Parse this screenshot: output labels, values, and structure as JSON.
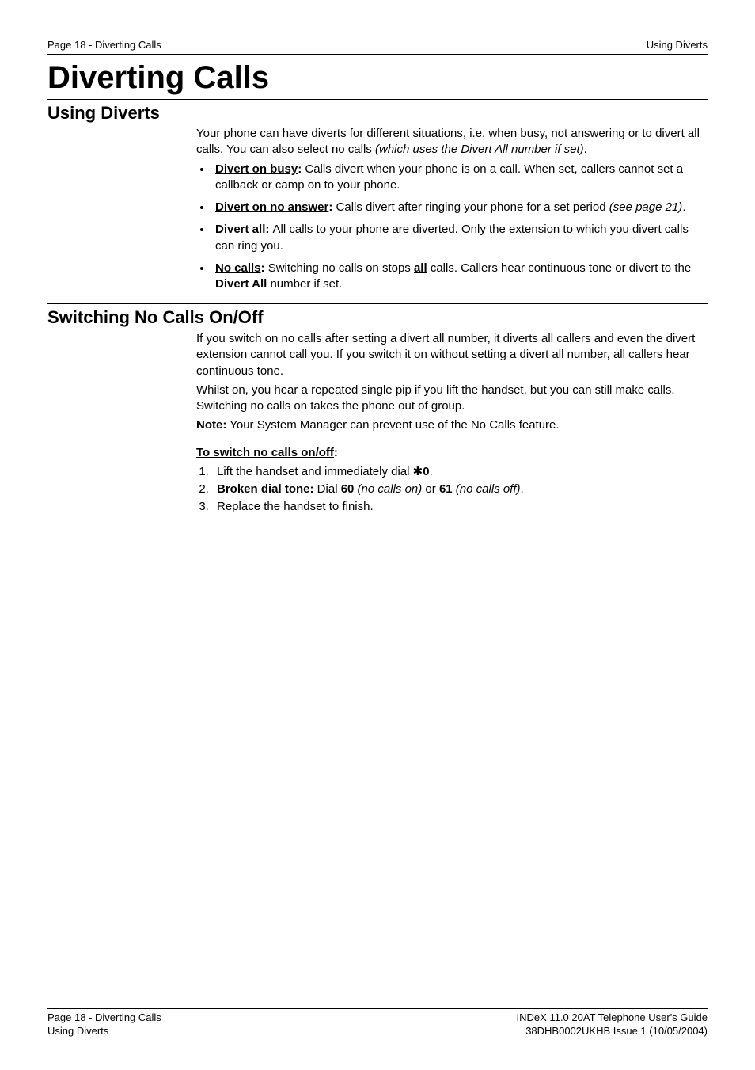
{
  "header": {
    "left": "Page 18 - Diverting Calls",
    "right": "Using Diverts"
  },
  "title": "Diverting Calls",
  "section1": {
    "heading": "Using Diverts",
    "intro_1": "Your phone can have diverts for different situations, i.e. when busy, not answering or to divert all calls. You can also select no calls ",
    "intro_em": "(which uses the Divert All number if set)",
    "intro_2": ".",
    "bullets": [
      {
        "head": "Divert on busy",
        "colon": ": ",
        "tail": "Calls divert when your phone is on a call. When set, callers cannot set a callback or camp on to your phone."
      },
      {
        "head": "Divert on no answer",
        "colon": ": ",
        "tail_pre": "Calls divert after ringing your phone for a set period ",
        "tail_em": "(see page 21)",
        "tail_post": "."
      },
      {
        "head": "Divert all",
        "colon": ": ",
        "tail": "All calls to your phone are diverted. Only the extension to which you divert calls can ring you."
      },
      {
        "head": "No calls",
        "colon": ": ",
        "tail_pre": "Switching no calls on stops ",
        "tail_u_b": "all",
        "tail_mid": " calls. Callers hear continuous tone or divert to the ",
        "tail_b": "Divert All",
        "tail_post": " number if set."
      }
    ]
  },
  "section2": {
    "heading": "Switching No Calls On/Off",
    "para1": "If you switch on no calls after setting a divert all number, it diverts all callers and even the divert extension cannot call you. If you switch it on without setting a divert all number, all callers hear continuous tone.",
    "para2": "Whilst on, you hear a repeated single pip if you lift the handset, but you can still make calls. Switching no calls on takes the phone out of group.",
    "note_label": "Note:",
    "note_text": "   Your System Manager can prevent use of the No Calls feature.",
    "proc_heading": "To switch no calls on/off",
    "proc_colon": ":",
    "steps": {
      "s1_pre": "Lift the handset and immediately dial ",
      "s1_star": "✱",
      "s1_b": "0",
      "s1_post": ".",
      "s2_b1": "Broken dial tone:",
      "s2_mid1": " Dial ",
      "s2_b2": "60",
      "s2_em1": " (no calls on)",
      "s2_mid2": " or ",
      "s2_b3": "61",
      "s2_em2": " (no calls off)",
      "s2_post": ".",
      "s3": "Replace the handset to finish."
    }
  },
  "footer": {
    "left1": "Page 18 - Diverting Calls",
    "left2": "Using Diverts",
    "right1": "INDeX 11.0 20AT Telephone User's Guide",
    "right2": "38DHB0002UKHB Issue 1 (10/05/2004)"
  }
}
